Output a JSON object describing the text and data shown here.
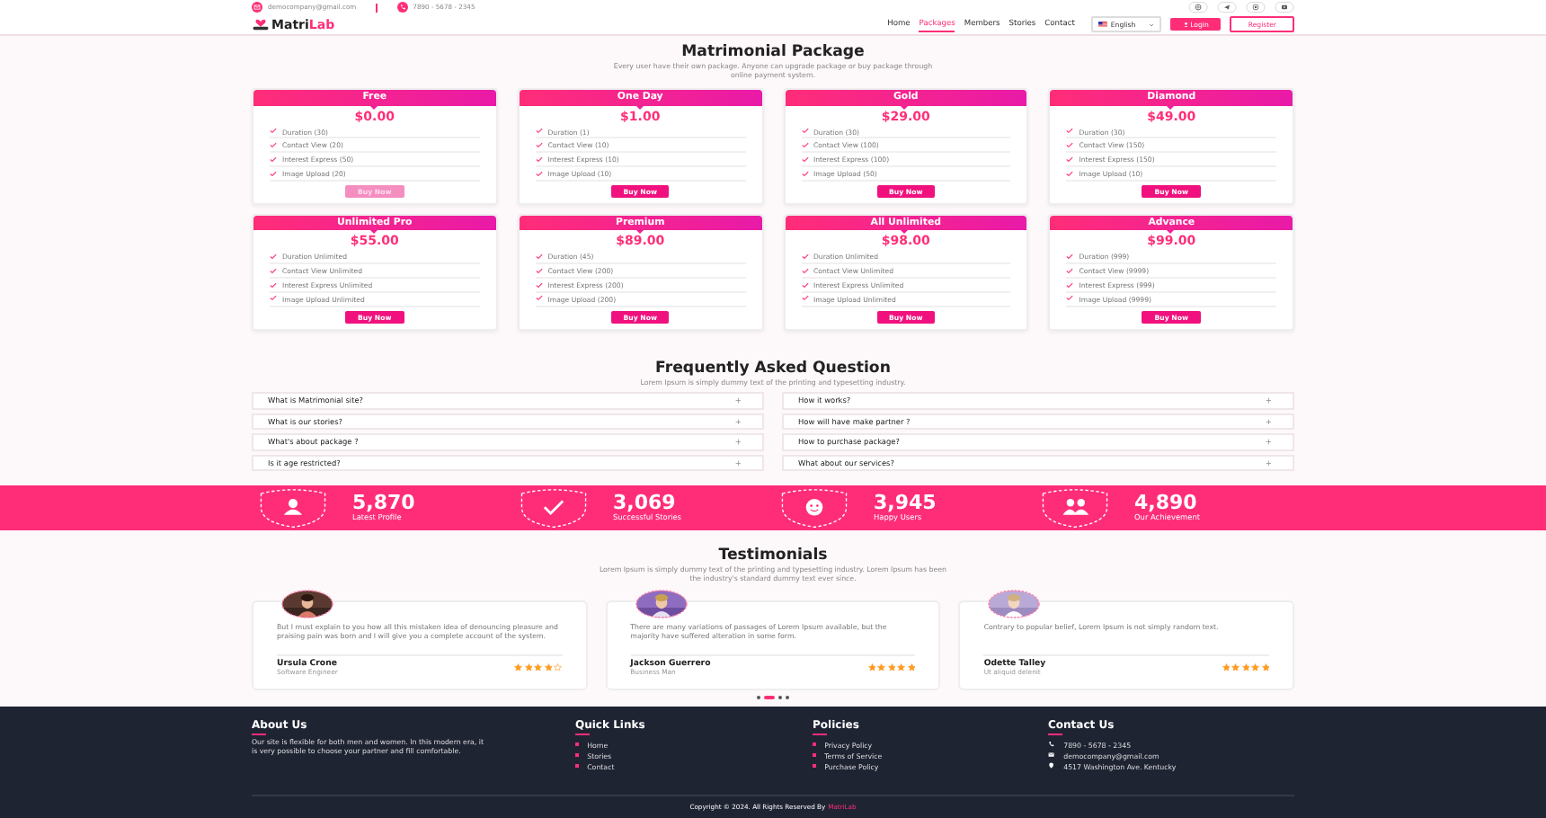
{
  "top_bar": {
    "email": "democompany@gmail.com",
    "phone": "7890 - 5678 - 2345"
  },
  "nav": {
    "logo_main": "Matri",
    "logo_accent": "Lab",
    "links": [
      {
        "label": "Home",
        "selected": false
      },
      {
        "label": "Packages",
        "selected": true
      },
      {
        "label": "Members",
        "selected": false
      },
      {
        "label": "Stories",
        "selected": false
      },
      {
        "label": "Contact",
        "selected": false
      }
    ],
    "language": "English",
    "login": "Login",
    "register": "Register"
  },
  "packages": {
    "title": "Matrimonial Package",
    "subtitle": "Every user have their own package. Anyone can upgrade package or buy package through online payment system.",
    "plans": [
      {
        "name": "Free",
        "price": "$0.00",
        "features": [
          "Duration (30)",
          "Contact View (20)",
          "Interest Express (50)",
          "Image Upload (20)"
        ],
        "button": "Buy Now",
        "disabled": true
      },
      {
        "name": "One Day",
        "price": "$1.00",
        "features": [
          "Duration (1)",
          "Contact View (10)",
          "Interest Express (10)",
          "Image Upload (10)"
        ],
        "button": "Buy Now",
        "disabled": false
      },
      {
        "name": "Gold",
        "price": "$29.00",
        "features": [
          "Duration (30)",
          "Contact View (100)",
          "Interest Express (100)",
          "Image Upload (50)"
        ],
        "button": "Buy Now",
        "disabled": false
      },
      {
        "name": "Diamond",
        "price": "$49.00",
        "features": [
          "Duration (30)",
          "Contact View (150)",
          "Interest Express (150)",
          "Image Upload (10)"
        ],
        "button": "Buy Now",
        "disabled": false
      },
      {
        "name": "Unlimited Pro",
        "price": "$55.00",
        "features": [
          "Duration Unlimited",
          "Contact View Unlimited",
          "Interest Express Unlimited",
          "Image Upload Unlimited"
        ],
        "button": "Buy Now",
        "disabled": false
      },
      {
        "name": "Premium",
        "price": "$89.00",
        "features": [
          "Duration (45)",
          "Contact View (200)",
          "Interest Express (200)",
          "Image Upload (200)"
        ],
        "button": "Buy Now",
        "disabled": false
      },
      {
        "name": "All Unlimited",
        "price": "$98.00",
        "features": [
          "Duration Unlimited",
          "Contact View Unlimited",
          "Interest Express Unlimited",
          "Image Upload Unlimited"
        ],
        "button": "Buy Now",
        "disabled": false
      },
      {
        "name": "Advance",
        "price": "$99.00",
        "features": [
          "Duration (999)",
          "Contact View (9999)",
          "Interest Express (999)",
          "Image Upload (9999)"
        ],
        "button": "Buy Now",
        "disabled": false
      }
    ]
  },
  "faq": {
    "title": "Frequently Asked Question",
    "subtitle": "Lorem Ipsum is simply dummy text of the printing and typesetting industry.",
    "questions": [
      {
        "text": "What is Matrimonial site?",
        "expanded": false
      },
      {
        "text": "How it works?",
        "expanded": false
      },
      {
        "text": "What is our stories?",
        "expanded": false
      },
      {
        "text": "How will have make partner ?",
        "expanded": false
      },
      {
        "text": "What's about package ?",
        "expanded": false
      },
      {
        "text": "How to purchase package?",
        "expanded": false
      },
      {
        "text": "Is it age restricted?",
        "expanded": false
      },
      {
        "text": "What about our services?",
        "expanded": false
      }
    ]
  },
  "stats": [
    {
      "value": "5,870",
      "label": "Latest Profile"
    },
    {
      "value": "3,069",
      "label": "Successful Stories"
    },
    {
      "value": "3,945",
      "label": "Happy Users"
    },
    {
      "value": "4,890",
      "label": "Our Achievement"
    }
  ],
  "testimonials": {
    "title": "Testimonials",
    "subtitle": "Lorem Ipsum is simply dummy text of the printing and typesetting industry. Lorem Ipsum has been the industry's standard dummy text ever since.",
    "items": [
      {
        "quote": "But I must explain to you how all this mistaken idea of denouncing pleasure and praising pain was born and I will give you a complete account of the system.",
        "name": "Ursula Crone",
        "role": "Software Engineer",
        "stars": 4
      },
      {
        "quote": "There are many variations of passages of Lorem Ipsum available, but the majority have suffered alteration in some form.",
        "name": "Jackson Guerrero",
        "role": "Business Man",
        "stars": 5
      },
      {
        "quote": "Contrary to popular belief, Lorem Ipsum is not simply random text.",
        "name": "Odette Talley",
        "role": "Ut aliquid delenit",
        "stars": 5
      }
    ],
    "pages": [
      {
        "selected": false
      },
      {
        "selected": true
      },
      {
        "selected": false
      },
      {
        "selected": false
      }
    ]
  },
  "footer": {
    "about": {
      "title": "About Us",
      "text": "Our site is flexible for both men and women. In this modern era, it is very possible to choose your partner and fill comfortable."
    },
    "quick_links": {
      "title": "Quick Links",
      "items": [
        "Home",
        "Stories",
        "Contact"
      ]
    },
    "policies": {
      "title": "Policies",
      "items": [
        "Privacy Policy",
        "Terms of Service",
        "Purchase Policy"
      ]
    },
    "contact": {
      "title": "Contact Us",
      "items": [
        "7890 - 5678 - 2345",
        "democompany@gmail.com",
        "4517 Washington Ave. Kentucky"
      ]
    },
    "copyright": "Copyright © 2024. All Rights Reserved By",
    "brand": "MatriLab"
  }
}
